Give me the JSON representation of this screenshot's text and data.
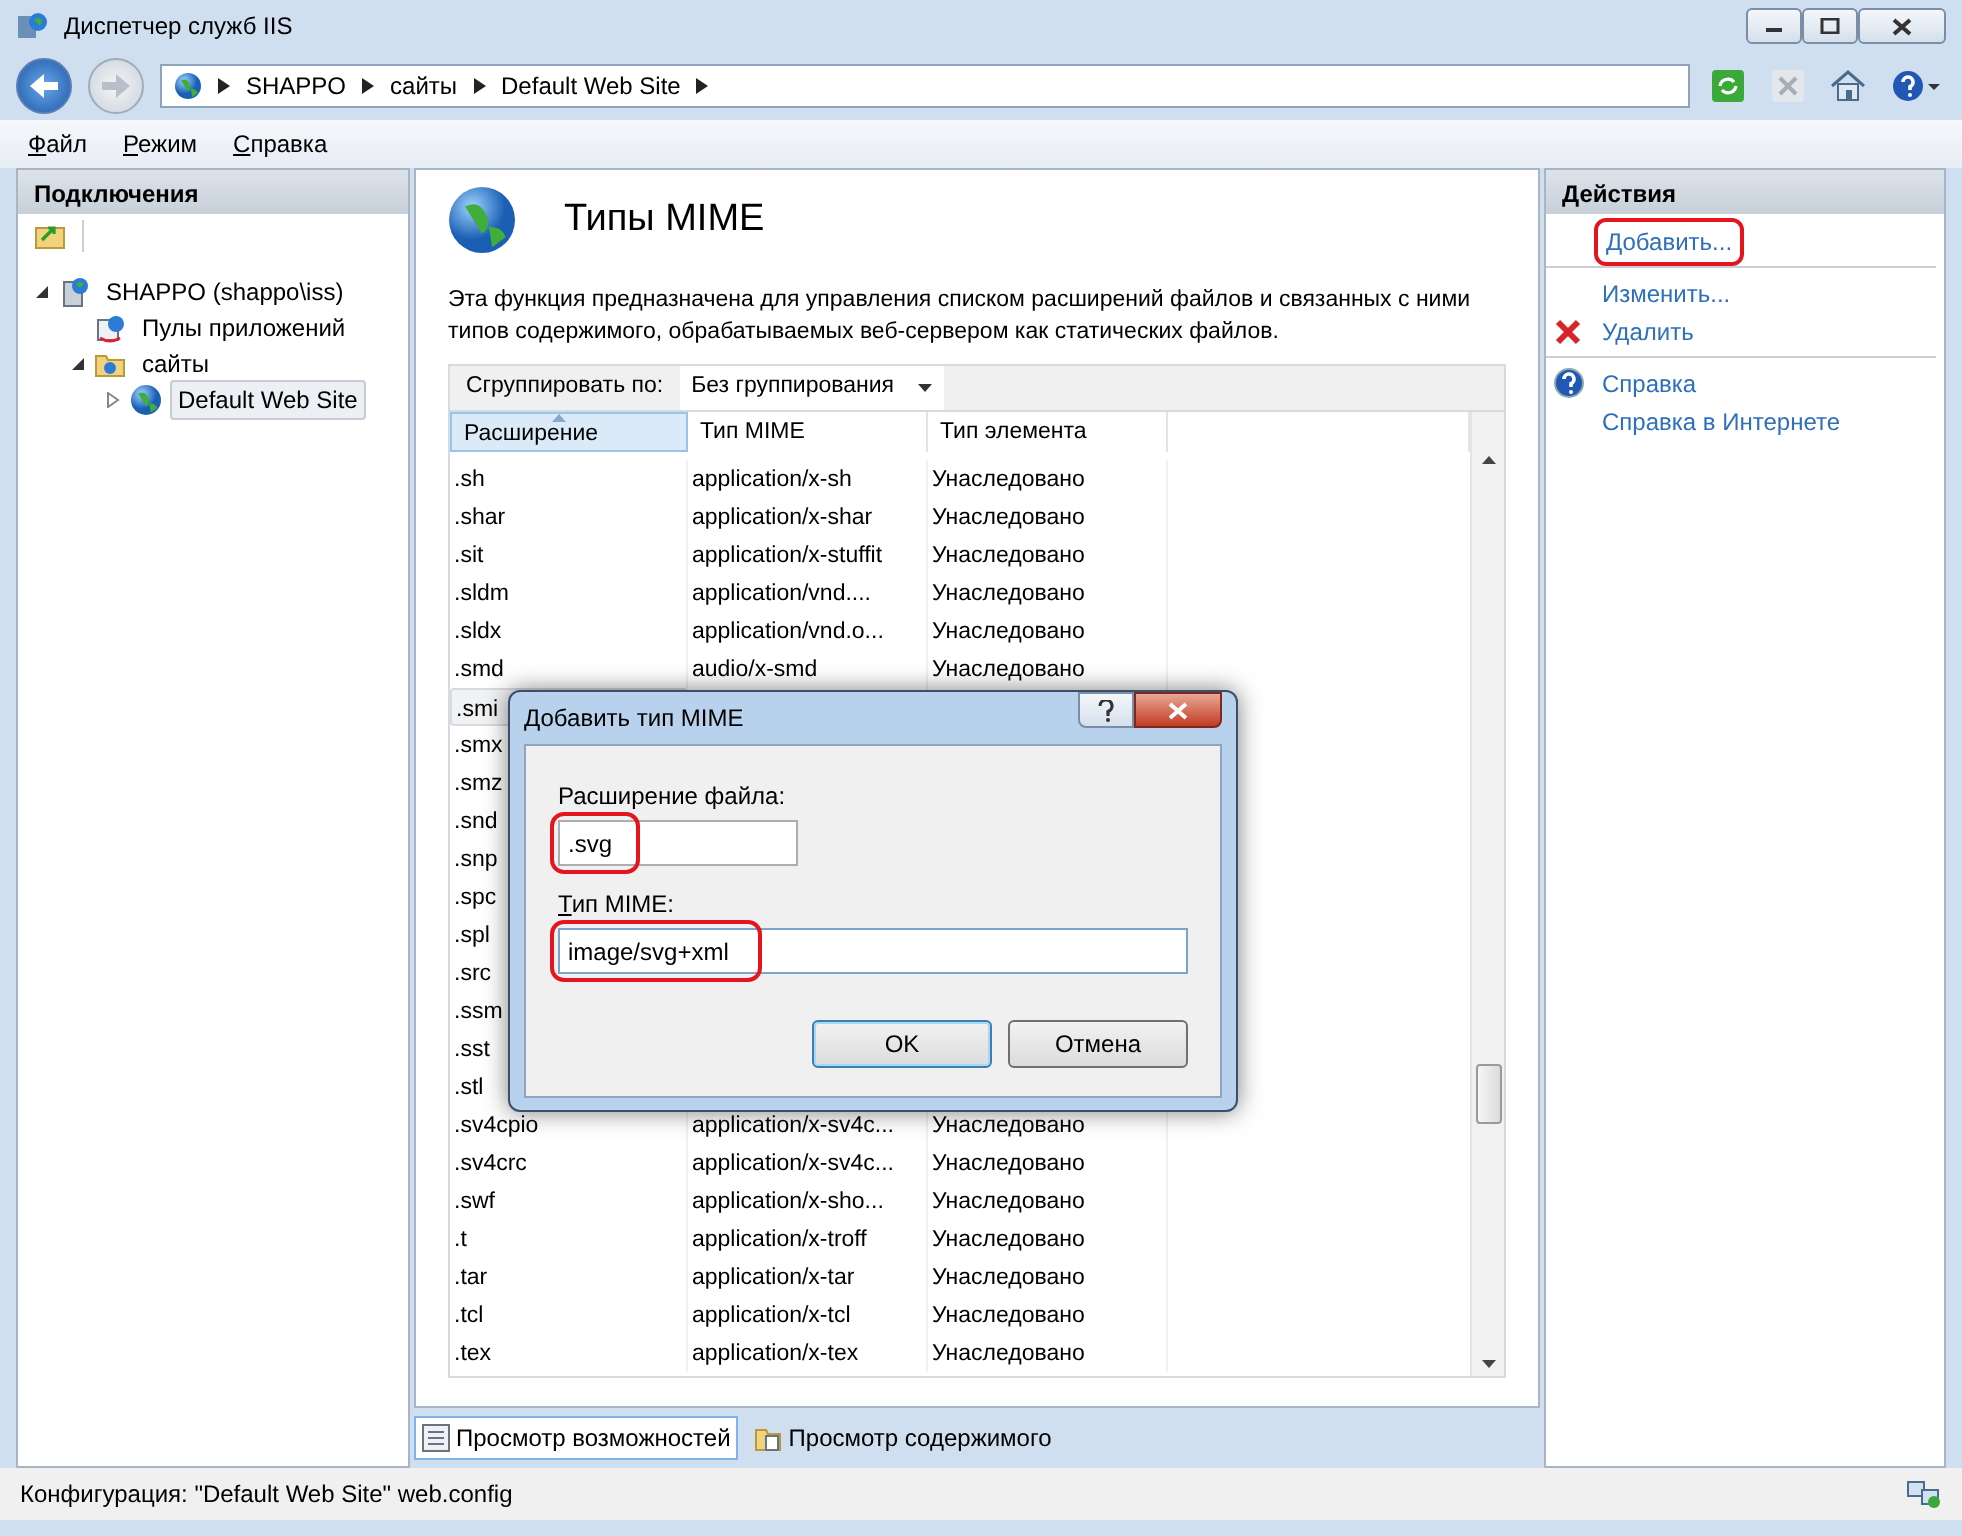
{
  "window": {
    "title": "Диспетчер служб IIS"
  },
  "address": {
    "crumbs": [
      "SHAPPO",
      "сайты",
      "Default Web Site"
    ]
  },
  "menu": [
    "Файл",
    "Режим",
    "Справка"
  ],
  "connections": {
    "title": "Подключения",
    "tree": [
      {
        "label": "SHAPPO (shappo\\iss)",
        "kind": "server",
        "expanded": true,
        "selected": false,
        "children": [
          {
            "label": "Пулы приложений",
            "kind": "pools",
            "selected": false
          },
          {
            "label": "сайты",
            "kind": "folder",
            "expanded": true,
            "selected": false,
            "children": [
              {
                "label": "Default Web Site",
                "kind": "site",
                "expanded": false,
                "selected": true
              }
            ]
          }
        ]
      }
    ]
  },
  "feature": {
    "title": "Типы MIME",
    "description": "Эта функция предназначена для управления списком расширений файлов и связанных с ними типов содержимого, обрабатываемых веб-сервером как статических файлов.",
    "group_by": {
      "label": "Сгруппировать по:",
      "value": "Без группирования"
    },
    "columns": [
      {
        "label": "Расширение",
        "sorted": true
      },
      {
        "label": "Тип MIME",
        "sorted": false
      },
      {
        "label": "Тип элемента",
        "sorted": false
      }
    ],
    "rows": [
      {
        "ext": ".sh",
        "mime": "application/x-sh",
        "type": "Унаследовано",
        "selected": false
      },
      {
        "ext": ".shar",
        "mime": "application/x-shar",
        "type": "Унаследовано",
        "selected": false
      },
      {
        "ext": ".sit",
        "mime": "application/x-stuffit",
        "type": "Унаследовано",
        "selected": false
      },
      {
        "ext": ".sldm",
        "mime": "application/vnd....",
        "type": "Унаследовано",
        "selected": false
      },
      {
        "ext": ".sldx",
        "mime": "application/vnd.o...",
        "type": "Унаследовано",
        "selected": false
      },
      {
        "ext": ".smd",
        "mime": "audio/x-smd",
        "type": "Унаследовано",
        "selected": false
      },
      {
        "ext": ".smi",
        "selected": true
      },
      {
        "ext": ".smx",
        "selected": false
      },
      {
        "ext": ".smz",
        "selected": false
      },
      {
        "ext": ".snd",
        "selected": false
      },
      {
        "ext": ".snp",
        "selected": false
      },
      {
        "ext": ".spc",
        "selected": false
      },
      {
        "ext": ".spl",
        "selected": false
      },
      {
        "ext": ".src",
        "selected": false
      },
      {
        "ext": ".ssm",
        "selected": false
      },
      {
        "ext": ".sst",
        "selected": false
      },
      {
        "ext": ".stl",
        "selected": false
      },
      {
        "ext": ".sv4cpio",
        "mime": "application/x-sv4c...",
        "type": "Унаследовано",
        "selected": false
      },
      {
        "ext": ".sv4crc",
        "mime": "application/x-sv4c...",
        "type": "Унаследовано",
        "selected": false
      },
      {
        "ext": ".swf",
        "mime": "application/x-sho...",
        "type": "Унаследовано",
        "selected": false
      },
      {
        "ext": ".t",
        "mime": "application/x-troff",
        "type": "Унаследовано",
        "selected": false
      },
      {
        "ext": ".tar",
        "mime": "application/x-tar",
        "type": "Унаследовано",
        "selected": false
      },
      {
        "ext": ".tcl",
        "mime": "application/x-tcl",
        "type": "Унаследовано",
        "selected": false
      },
      {
        "ext": ".tex",
        "mime": "application/x-tex",
        "type": "Унаследовано",
        "selected": false
      }
    ]
  },
  "views": [
    {
      "label": "Просмотр возможностей",
      "kind": "features",
      "selected": true
    },
    {
      "label": "Просмотр содержимого",
      "kind": "content",
      "selected": false
    }
  ],
  "actions": {
    "title": "Действия",
    "groups": [
      [
        {
          "label": "Добавить...",
          "kind": "plain",
          "highlighted": true
        }
      ],
      [
        {
          "label": "Изменить...",
          "kind": "plain",
          "highlighted": false
        },
        {
          "label": "Удалить",
          "kind": "delete",
          "highlighted": false
        }
      ],
      [
        {
          "label": "Справка",
          "kind": "help",
          "highlighted": false
        },
        {
          "label": "Справка в Интернете",
          "kind": "plain",
          "highlighted": false
        }
      ]
    ]
  },
  "dialog": {
    "title": "Добавить тип MIME",
    "fields": [
      {
        "label": "Расширение файла:",
        "value": ".svg",
        "kind": "short",
        "access_key": false,
        "highlighted": true
      },
      {
        "label": "Тип MIME:",
        "value": "image/svg+xml",
        "kind": "long",
        "access_key": true,
        "highlighted": true
      }
    ],
    "buttons": [
      {
        "label": "OK",
        "default": true
      },
      {
        "label": "Отмена",
        "default": false
      }
    ]
  },
  "status_bar": "Конфигурация: \"Default Web Site\" web.config"
}
